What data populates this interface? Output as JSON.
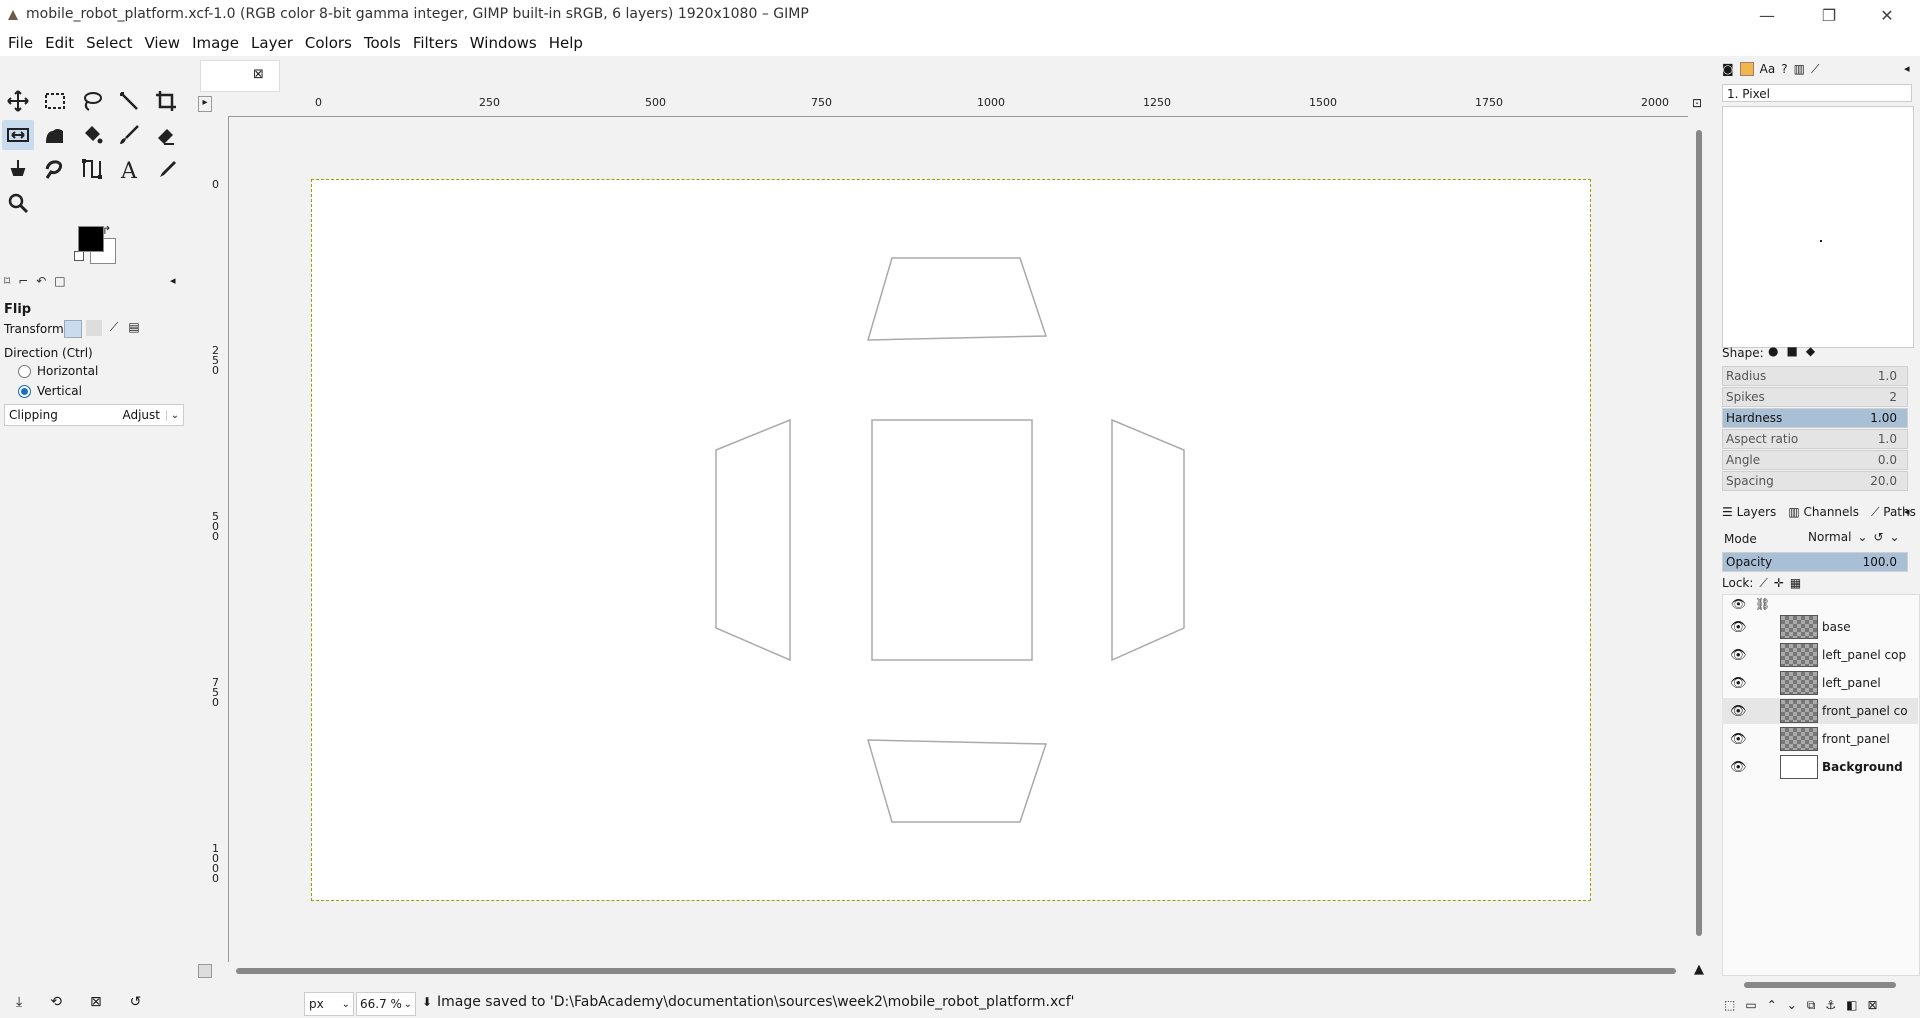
{
  "window": {
    "title": "mobile_robot_platform.xcf-1.0 (RGB color 8-bit gamma integer, GIMP built-in sRGB, 6 layers) 1920x1080 – GIMP",
    "minimize_icon": "minimize-icon",
    "restore_icon": "restore-icon",
    "close_icon": "close-icon"
  },
  "menu": [
    "File",
    "Edit",
    "Select",
    "View",
    "Image",
    "Layer",
    "Colors",
    "Tools",
    "Filters",
    "Windows",
    "Help"
  ],
  "toolbox": {
    "tools": [
      "move-tool-icon",
      "rect-select-icon",
      "free-select-icon",
      "fuzzy-select-icon",
      "crop-icon",
      "flip-tool-icon",
      "warp-icon",
      "bucket-fill-icon",
      "paintbrush-icon",
      "eraser-icon",
      "clone-icon",
      "smudge-icon",
      "paths-icon",
      "text-icon",
      "color-picker-icon",
      "zoom-icon"
    ],
    "fg_color": "#000000",
    "bg_color": "#ffffff"
  },
  "tool_options": {
    "title": "Flip",
    "transform_label": "Transform:",
    "direction_label": "Direction  (Ctrl)",
    "horizontal": "Horizontal",
    "vertical": "Vertical",
    "selected_direction": "Vertical",
    "clipping_label": "Clipping",
    "clipping_value": "Adjust"
  },
  "rulers": {
    "h_labels": [
      "0",
      "250",
      "500",
      "750",
      "1000",
      "1250",
      "1500",
      "1750",
      "2000"
    ],
    "v_labels": [
      "0",
      "250",
      "500",
      "750",
      "1000"
    ]
  },
  "status": {
    "unit": "px",
    "zoom": "66.7 %",
    "message": "Image saved to 'D:\\FabAcademy\\documentation\\sources\\week2\\mobile_robot_platform.xcf'"
  },
  "brushes": {
    "selected_brush": "1. Pixel",
    "shape_label": "Shape:"
  },
  "brush_params": [
    {
      "label": "Radius",
      "value": "1.0"
    },
    {
      "label": "Spikes",
      "value": "2"
    },
    {
      "label": "Hardness",
      "value": "1.00"
    },
    {
      "label": "Aspect ratio",
      "value": "1.0"
    },
    {
      "label": "Angle",
      "value": "0.0"
    },
    {
      "label": "Spacing",
      "value": "20.0"
    }
  ],
  "layers_panel": {
    "tabs": [
      "Layers",
      "Channels",
      "Paths"
    ],
    "mode_label": "Mode",
    "mode_value": "Normal",
    "opacity_label": "Opacity",
    "opacity_value": "100.0",
    "lock_label": "Lock:",
    "layers": [
      {
        "name": "base",
        "thumb": "checker"
      },
      {
        "name": "left_panel cop",
        "thumb": "checker"
      },
      {
        "name": "left_panel",
        "thumb": "checker"
      },
      {
        "name": "front_panel co",
        "thumb": "checker"
      },
      {
        "name": "front_panel",
        "thumb": "checker"
      },
      {
        "name": "Background",
        "thumb": "white"
      }
    ]
  }
}
